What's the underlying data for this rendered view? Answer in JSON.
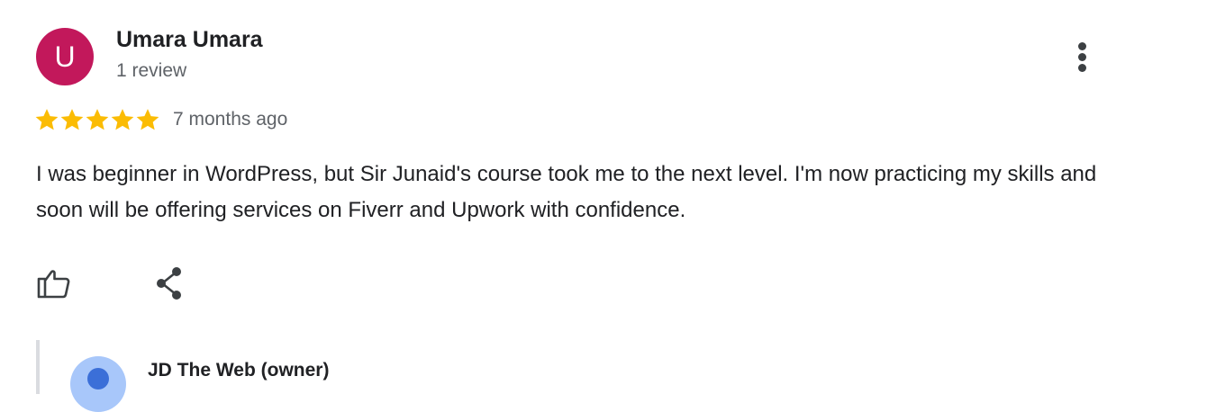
{
  "review": {
    "avatar_letter": "U",
    "avatar_color": "#c2185b",
    "reviewer_name": "Umara Umara",
    "review_count": "1 review",
    "rating_stars": 5,
    "rating_max": 5,
    "star_color": "#fbbc04",
    "time_ago": "7 months ago",
    "text": "I was beginner in WordPress, but Sir Junaid's course took me to the next level. I'm now practicing my skills and soon will be offering services on Fiverr and Upwork with confidence.",
    "actions": {
      "like_icon": "thumbs-up-icon",
      "share_icon": "share-icon",
      "more_icon": "more-vert-icon"
    }
  },
  "owner_reply": {
    "name": "JD The Web (owner)",
    "avatar_color": "#a8c7fa"
  }
}
